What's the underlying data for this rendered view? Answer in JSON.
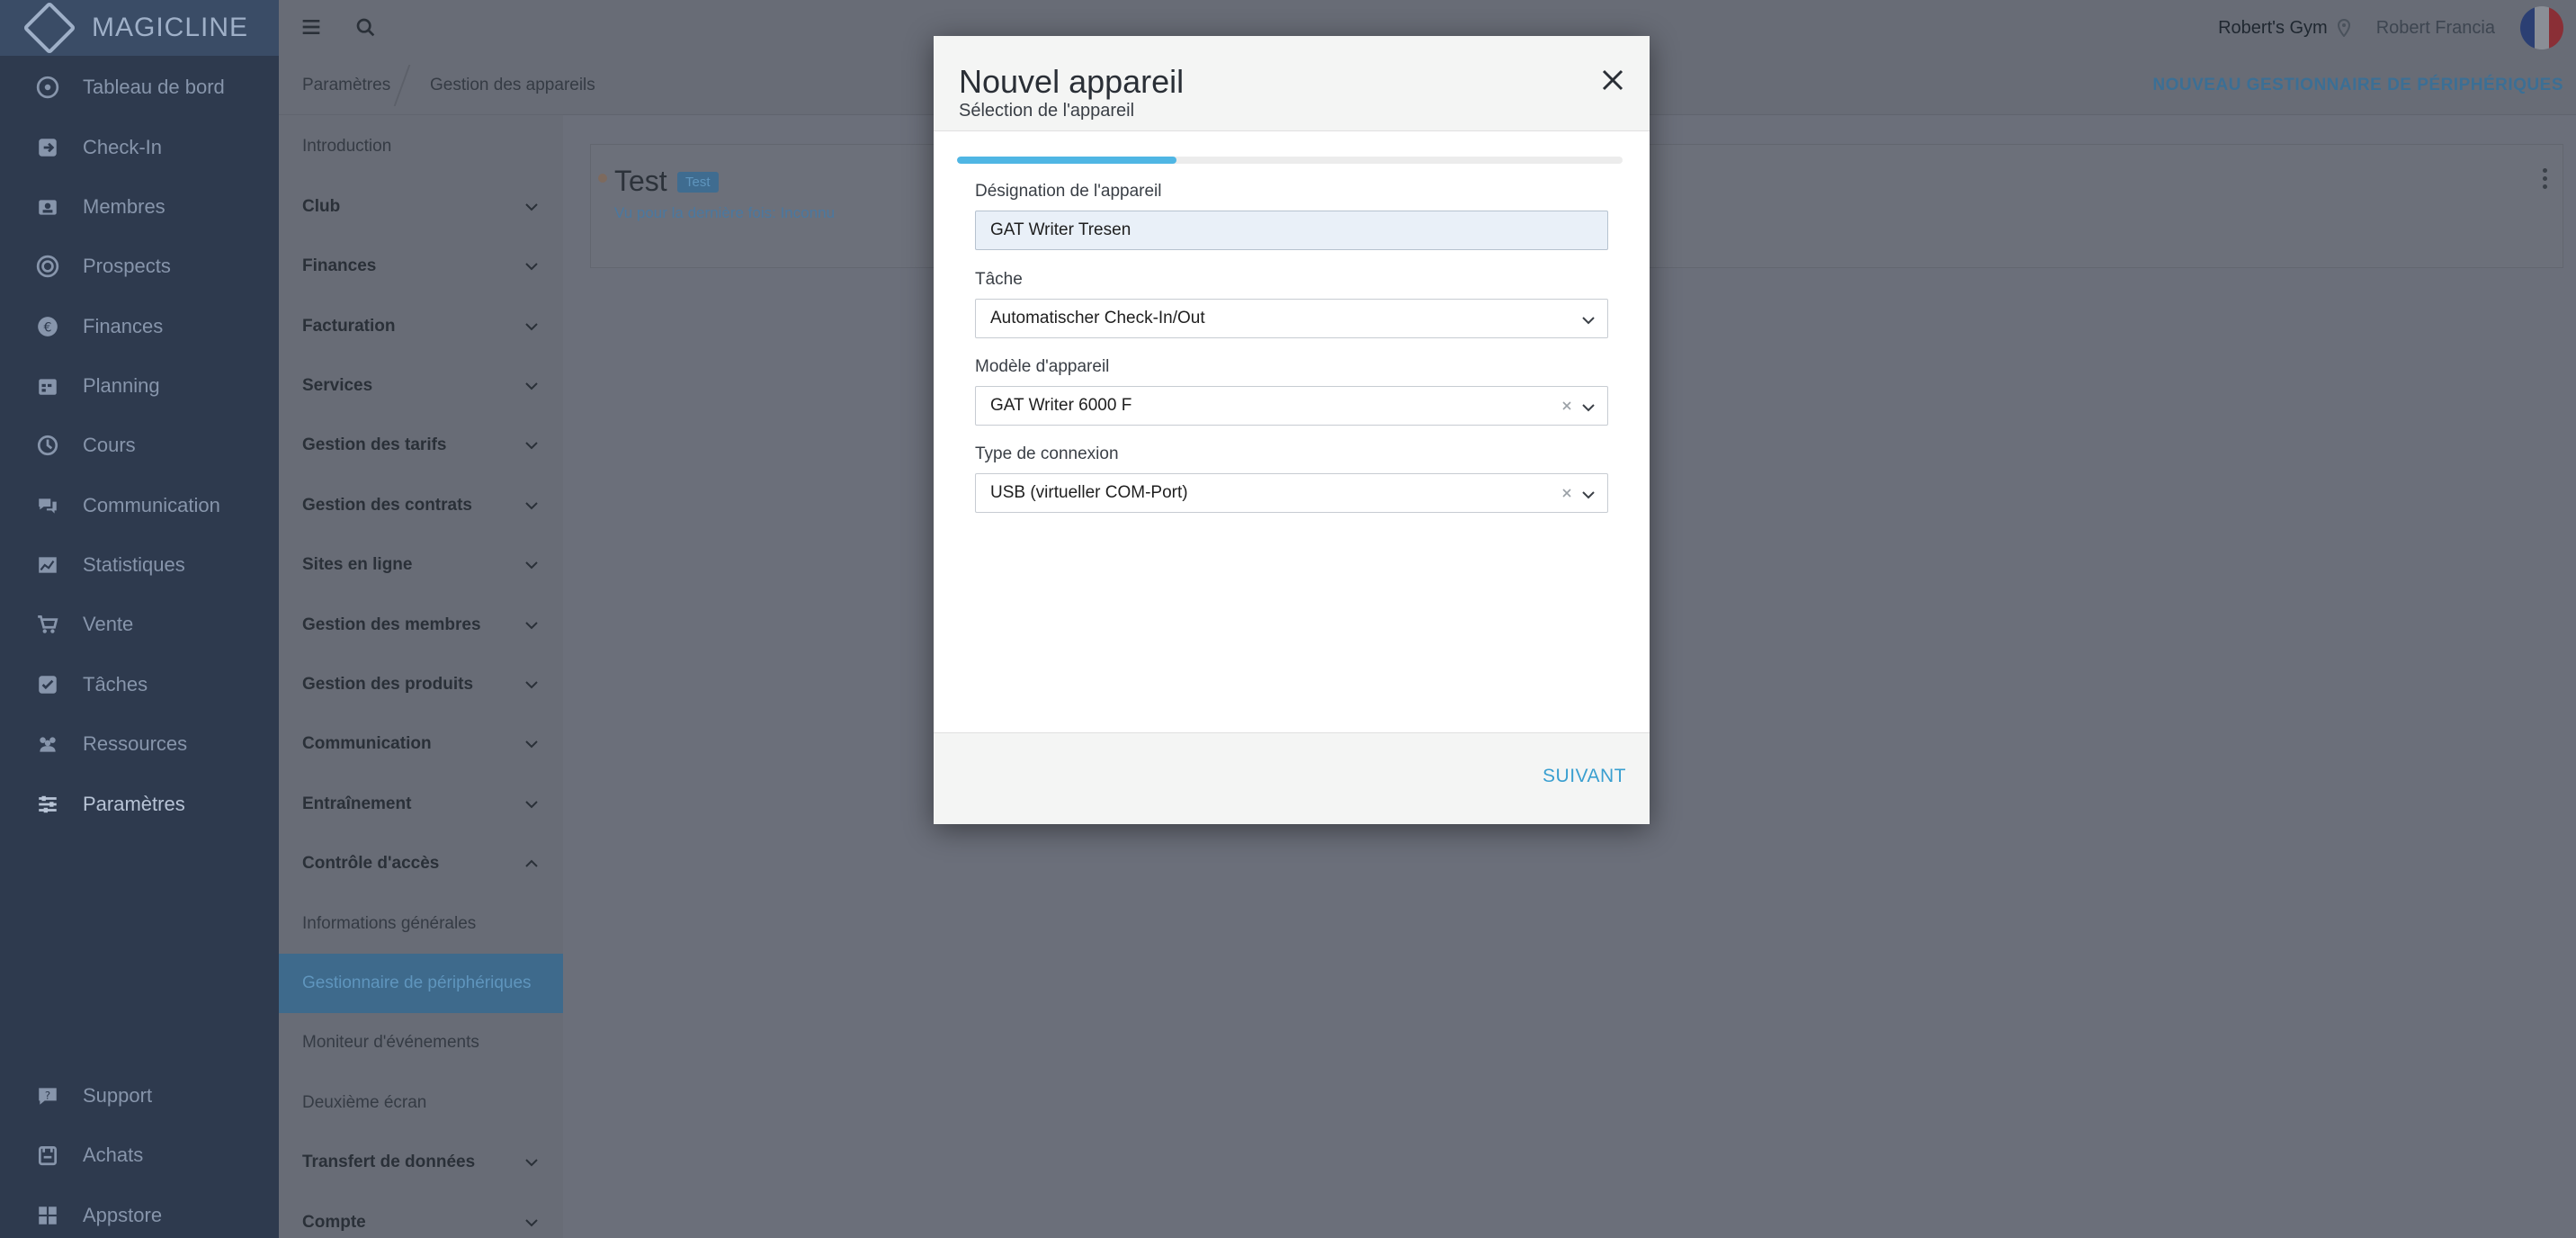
{
  "app": {
    "logo_text": "MAGICLINE"
  },
  "sidebar": {
    "items": [
      {
        "label": "Tableau de bord",
        "icon": "dashboard-icon"
      },
      {
        "label": "Check-In",
        "icon": "check-in-icon"
      },
      {
        "label": "Membres",
        "icon": "members-icon"
      },
      {
        "label": "Prospects",
        "icon": "prospects-icon"
      },
      {
        "label": "Finances",
        "icon": "finances-icon"
      },
      {
        "label": "Planning",
        "icon": "calendar-icon"
      },
      {
        "label": "Cours",
        "icon": "courses-icon"
      },
      {
        "label": "Communication",
        "icon": "chat-icon"
      },
      {
        "label": "Statistiques",
        "icon": "chart-icon"
      },
      {
        "label": "Vente",
        "icon": "cart-icon"
      },
      {
        "label": "Tâches",
        "icon": "tasks-icon"
      },
      {
        "label": "Ressources",
        "icon": "resources-icon"
      },
      {
        "label": "Paramètres",
        "icon": "settings-sliders-icon"
      }
    ],
    "bottom_items": [
      {
        "label": "Support",
        "icon": "support-icon"
      },
      {
        "label": "Achats",
        "icon": "purchases-icon"
      },
      {
        "label": "Appstore",
        "icon": "appstore-icon"
      }
    ]
  },
  "topbar": {
    "gym": "Robert's Gym",
    "user": "Robert Francia"
  },
  "breadcrumb": {
    "items": [
      "Paramètres",
      "Gestion des appareils"
    ],
    "action": "NOUVEAU GESTIONNAIRE DE PÉRIPHÉRIQUES"
  },
  "subnav": {
    "items": [
      {
        "label": "Introduction",
        "plain": true
      },
      {
        "label": "Club"
      },
      {
        "label": "Finances"
      },
      {
        "label": "Facturation"
      },
      {
        "label": "Services"
      },
      {
        "label": "Gestion des tarifs"
      },
      {
        "label": "Gestion des contrats"
      },
      {
        "label": "Sites en ligne"
      },
      {
        "label": "Gestion des membres"
      },
      {
        "label": "Gestion des produits"
      },
      {
        "label": "Communication"
      },
      {
        "label": "Entraînement"
      },
      {
        "label": "Contrôle d'accès",
        "expanded": true
      },
      {
        "label": "Informations générales",
        "plain": true
      },
      {
        "label": "Gestionnaire de périphériques",
        "plain": true,
        "selected": true
      },
      {
        "label": "Moniteur d'événements",
        "plain": true
      },
      {
        "label": "Deuxième écran",
        "plain": true
      },
      {
        "label": "Transfert de données"
      },
      {
        "label": "Compte"
      }
    ]
  },
  "card": {
    "title": "Test",
    "badge": "Test",
    "subtitle": "Vu pour la dernière fois: Inconnu"
  },
  "modal": {
    "title": "Nouvel appareil",
    "subtitle": "Sélection de l'appareil",
    "progress": 0.33,
    "fields": {
      "designation": {
        "label": "Désignation de l'appareil",
        "value": "GAT Writer Tresen"
      },
      "task": {
        "label": "Tâche",
        "value": "Automatischer Check-In/Out"
      },
      "model": {
        "label": "Modèle d'appareil",
        "value": "GAT Writer 6000 F"
      },
      "connection": {
        "label": "Type de connexion",
        "value": "USB (virtueller COM-Port)"
      }
    },
    "next_label": "SUIVANT"
  },
  "colors": {
    "accent": "#4fb6e4",
    "nav_bg": "#2e3a4e",
    "overlay": "#6b6f7a"
  }
}
